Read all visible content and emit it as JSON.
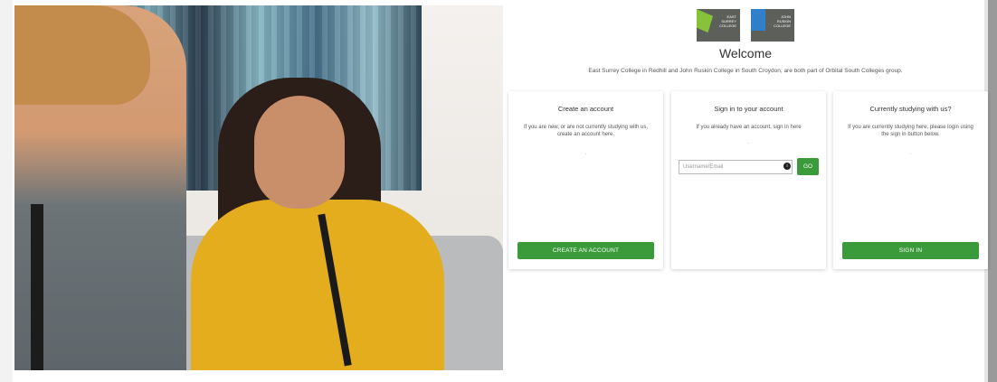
{
  "brand": {
    "logos": [
      {
        "name": "East Surrey College",
        "lines": [
          "EAST",
          "SURREY",
          "COLLEGE"
        ],
        "accent": "#86c23a"
      },
      {
        "name": "John Ruskin College",
        "lines": [
          "JOHN",
          "RUSKIN",
          "COLLEGE"
        ],
        "accent": "#2f7fc9"
      }
    ]
  },
  "header": {
    "title": "Welcome",
    "subtitle": "East Surrey College in Redhill and John Ruskin College in South Croydon, are both part of Orbital South Colleges group."
  },
  "cards": {
    "create": {
      "title": "Create an account",
      "body": "If you are new, or are not currently studying with us, create an account here.",
      "dot": ".",
      "button": "CREATE AN ACCOUNT"
    },
    "signin": {
      "title": "Sign in to your account",
      "body": "If you already have an account, sign in here",
      "dot": ".",
      "input_placeholder": "Username/Email",
      "info_glyph": "i",
      "go_button": "GO"
    },
    "current": {
      "title": "Currently studying with us?",
      "body": "If you are currently studying here, please login using the sign in button below.",
      "dot": ".",
      "button": "SIGN IN"
    }
  },
  "colors": {
    "primary_button": "#3b9a3a"
  }
}
